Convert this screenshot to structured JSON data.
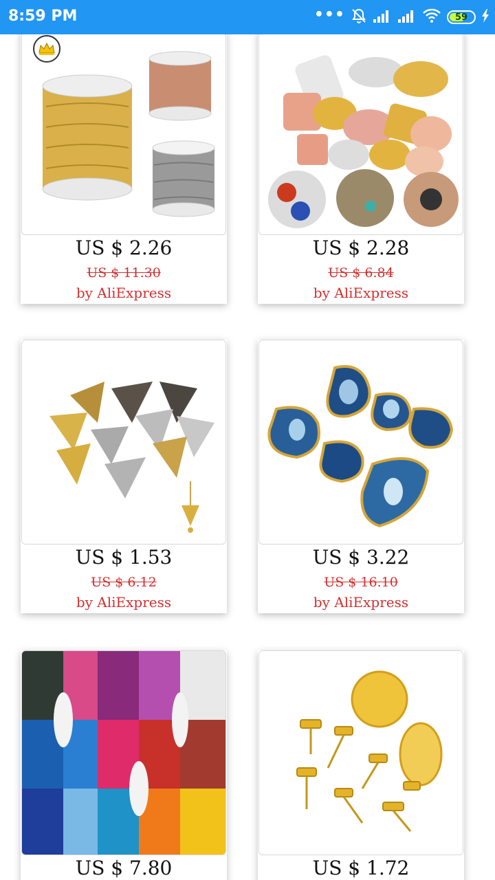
{
  "status_bar": {
    "time": "8:59 PM",
    "battery_level": "59",
    "icons": [
      "more-dots-icon",
      "alarm-off-icon",
      "signal-icon",
      "signal-icon",
      "wifi-icon",
      "battery-icon",
      "charging-icon"
    ]
  },
  "products": [
    {
      "price": "US $ 2.26",
      "old_price": "US $ 11.30",
      "seller": "by AliExpress",
      "image": "chain-spools-image",
      "badge": "crown-icon"
    },
    {
      "price": "US $ 2.28",
      "old_price": "US $ 6.84",
      "seller": "by AliExpress",
      "image": "earring-studs-image"
    },
    {
      "price": "US $ 1.53",
      "old_price": "US $ 6.12",
      "seller": "by AliExpress",
      "image": "filigree-bead-caps-image"
    },
    {
      "price": "US $ 3.22",
      "old_price": "US $ 16.10",
      "seller": "by AliExpress",
      "image": "agate-pendants-image"
    },
    {
      "price": "US $ 7.80",
      "old_price": "",
      "seller": "",
      "image": "thread-spools-image"
    },
    {
      "price": "US $ 1.72",
      "old_price": "",
      "seller": "",
      "image": "ear-post-findings-image"
    }
  ],
  "colors": {
    "status_bar": "#2196f3",
    "price_text": "#111111",
    "seller_text": "#d32f2f",
    "battery_fill": "#c6ff3d"
  }
}
